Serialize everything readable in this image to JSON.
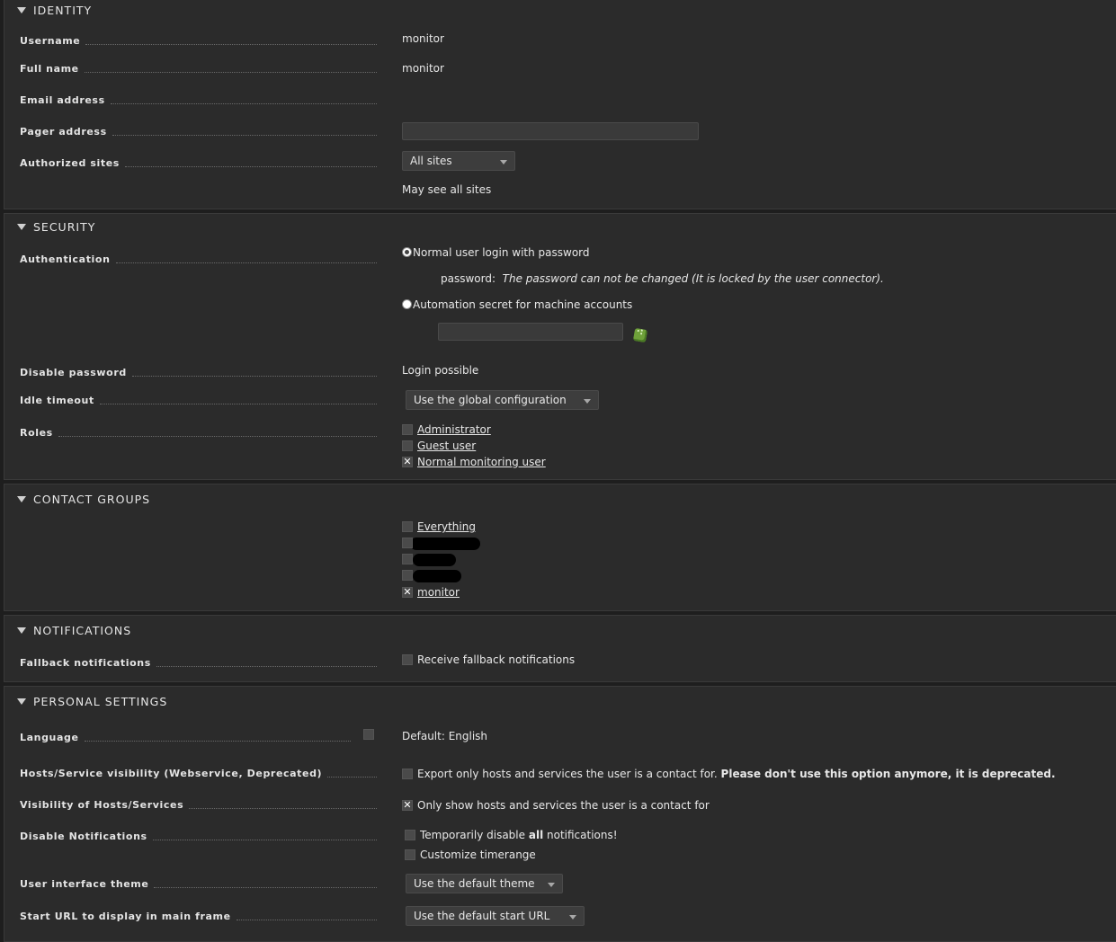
{
  "identity": {
    "title": "IDENTITY",
    "username_label": "Username",
    "username_value": "monitor",
    "fullname_label": "Full name",
    "fullname_value": "monitor",
    "email_label": "Email address",
    "pager_label": "Pager address",
    "sites_label": "Authorized sites",
    "sites_value": "All sites",
    "sites_note": "May see all sites"
  },
  "security": {
    "title": "SECURITY",
    "auth_label": "Authentication",
    "auth_option_password": "Normal user login with password",
    "password_prefix": "password:",
    "password_note": "The password can not be changed (It is locked by the user connector).",
    "auth_option_automation": "Automation secret for machine accounts",
    "disable_pw_label": "Disable password",
    "disable_pw_value": "Login possible",
    "idle_label": "Idle timeout",
    "idle_value": "Use the global configuration",
    "roles_label": "Roles",
    "roles": [
      {
        "label": "Administrator",
        "checked": false
      },
      {
        "label": "Guest user",
        "checked": false
      },
      {
        "label": "Normal monitoring user",
        "checked": true
      }
    ]
  },
  "contact_groups": {
    "title": "CONTACT GROUPS",
    "first": "Everything",
    "last": "monitor"
  },
  "notifications": {
    "title": "NOTIFICATIONS",
    "fallback_label": "Fallback notifications",
    "fallback_value": "Receive fallback notifications"
  },
  "personal": {
    "title": "PERSONAL SETTINGS",
    "language_label": "Language",
    "language_value": "Default: English",
    "hsv_label": "Hosts/Service visibility (Webservice, Deprecated)",
    "hsv_text": "Export only hosts and services the user is a contact for.",
    "hsv_bold": "Please don't use this option anymore, it is deprecated.",
    "vis_label": "Visibility of Hosts/Services",
    "vis_value": "Only show hosts and services the user is a contact for",
    "disnot_label": "Disable Notifications",
    "disnot_pre": "Temporarily disable",
    "disnot_bold": "all",
    "disnot_post": "notifications!",
    "timerange": "Customize timerange",
    "theme_label": "User interface theme",
    "theme_value": "Use the default theme",
    "starturl_label": "Start URL to display in main frame",
    "starturl_value": "Use the default start URL"
  }
}
